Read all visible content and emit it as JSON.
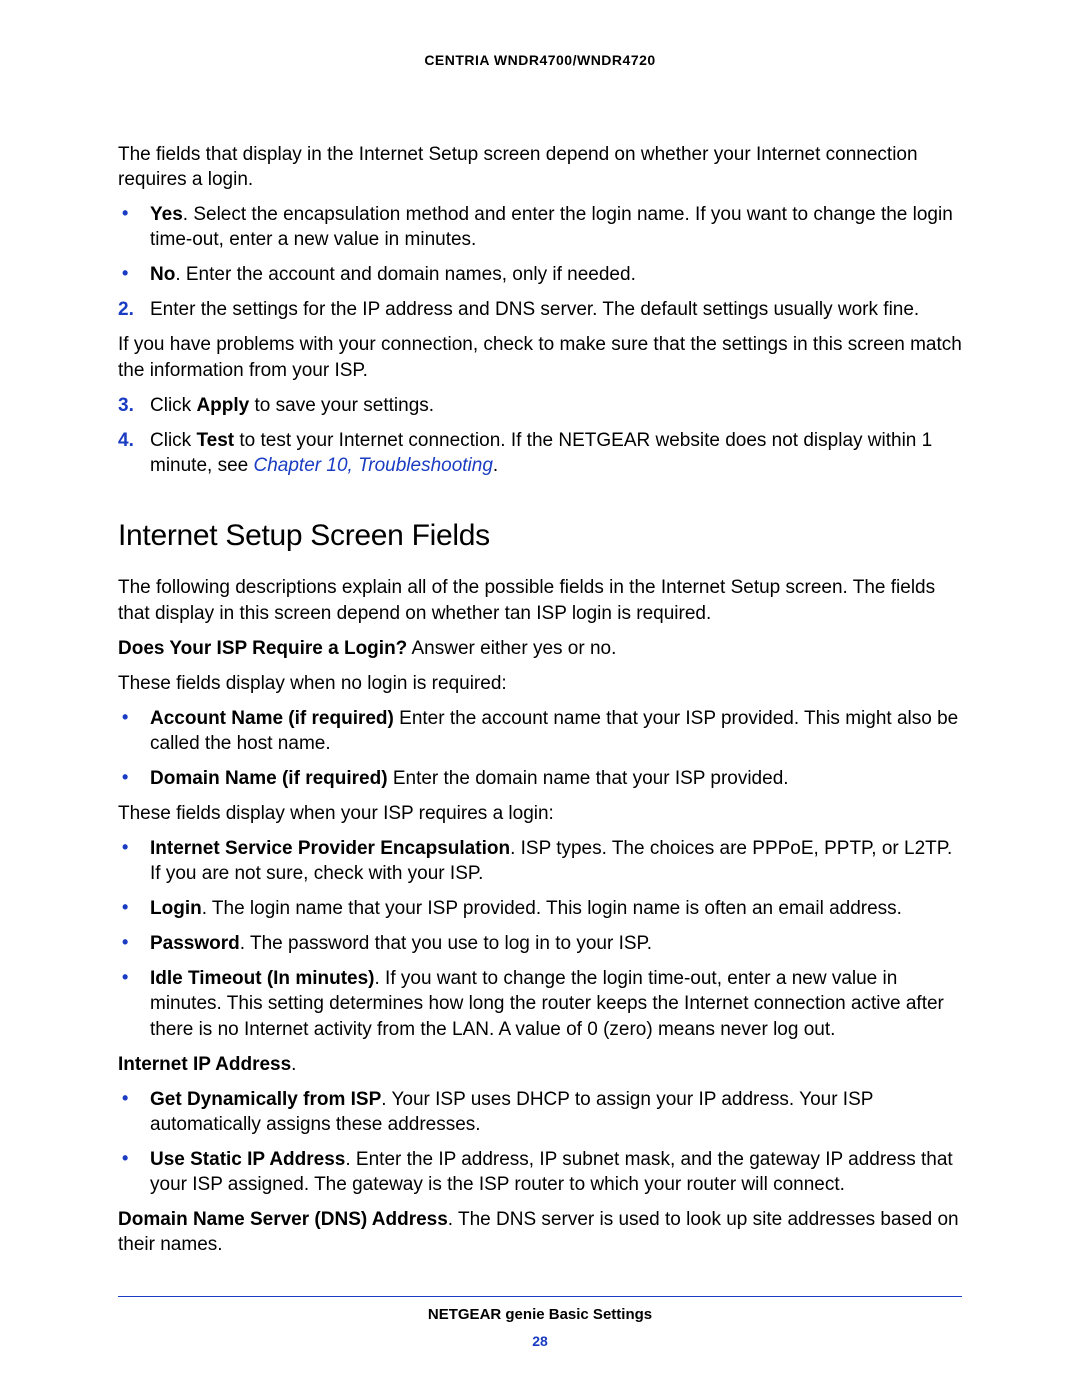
{
  "header": {
    "title": "CENTRIA WNDR4700/WNDR4720"
  },
  "intro": "The fields that display in the Internet Setup screen depend on whether your Internet connection requires a login.",
  "yesBullet": {
    "label": "Yes",
    "text": ". Select the encapsulation method and enter the login name. If you want to change the login time-out, enter a new value in minutes."
  },
  "noBullet": {
    "label": "No",
    "text": ". Enter the account and domain names, only if needed."
  },
  "step2": {
    "marker": "2.",
    "text": "Enter the settings for the IP address and DNS server. The default settings usually work fine."
  },
  "step2b": "If you have problems with your connection, check to make sure that the settings in this screen match the information from your ISP.",
  "step3": {
    "marker": "3.",
    "pre": "Click ",
    "bold": "Apply",
    "post": " to save your settings."
  },
  "step4": {
    "marker": "4.",
    "pre": "Click ",
    "bold": "Test",
    "post": " to test your Internet connection. If the NETGEAR website does not display within 1 minute, see ",
    "link": "Chapter 10, Troubleshooting",
    "end": "."
  },
  "heading": "Internet Setup Screen Fields",
  "desc": "The following descriptions explain all of the possible fields in the Internet Setup screen. The fields that display in this screen depend on whether tan ISP login is required.",
  "q1": {
    "bold": "Does Your ISP Require a Login?",
    "text": " Answer either yes or no."
  },
  "noLoginIntro": "These fields display when no login is required:",
  "acct": {
    "bold": "Account Name (if required)",
    "text": " Enter the account name that your ISP provided. This might also be called the host name."
  },
  "domain": {
    "bold": "Domain Name (if required)",
    "text": " Enter the domain name that your ISP provided."
  },
  "loginIntro": "These fields display when your ISP requires a login:",
  "encap": {
    "bold": "Internet Service Provider Encapsulation",
    "text": ". ISP types. The choices are PPPoE, PPTP, or L2TP. If you are not sure, check with your ISP."
  },
  "login": {
    "bold": "Login",
    "text": ". The login name that your ISP provided. This login name is often an email address."
  },
  "password": {
    "bold": "Password",
    "text": ". The password that you use to log in to your ISP."
  },
  "idle": {
    "bold": "Idle Timeout (In minutes)",
    "text": ". If you want to change the login time-out, enter a new value in minutes. This setting determines how long the router keeps the Internet connection active after there is no Internet activity from the LAN. A value of 0 (zero) means never log out."
  },
  "ipHeading": {
    "bold": "Internet IP Address",
    "text": "."
  },
  "dhcp": {
    "bold": "Get Dynamically from ISP",
    "text": ". Your ISP uses DHCP to assign your IP address. Your ISP automatically assigns these addresses."
  },
  "static": {
    "bold": "Use Static IP Address",
    "text": ". Enter the IP address, IP subnet mask, and the gateway IP address that your ISP assigned. The gateway is the ISP router to which your router will connect."
  },
  "dns": {
    "bold": "Domain Name Server (DNS) Address",
    "text": ". The DNS server is used to look up site addresses based on their names."
  },
  "footer": {
    "title": "NETGEAR genie Basic Settings",
    "page": "28"
  }
}
